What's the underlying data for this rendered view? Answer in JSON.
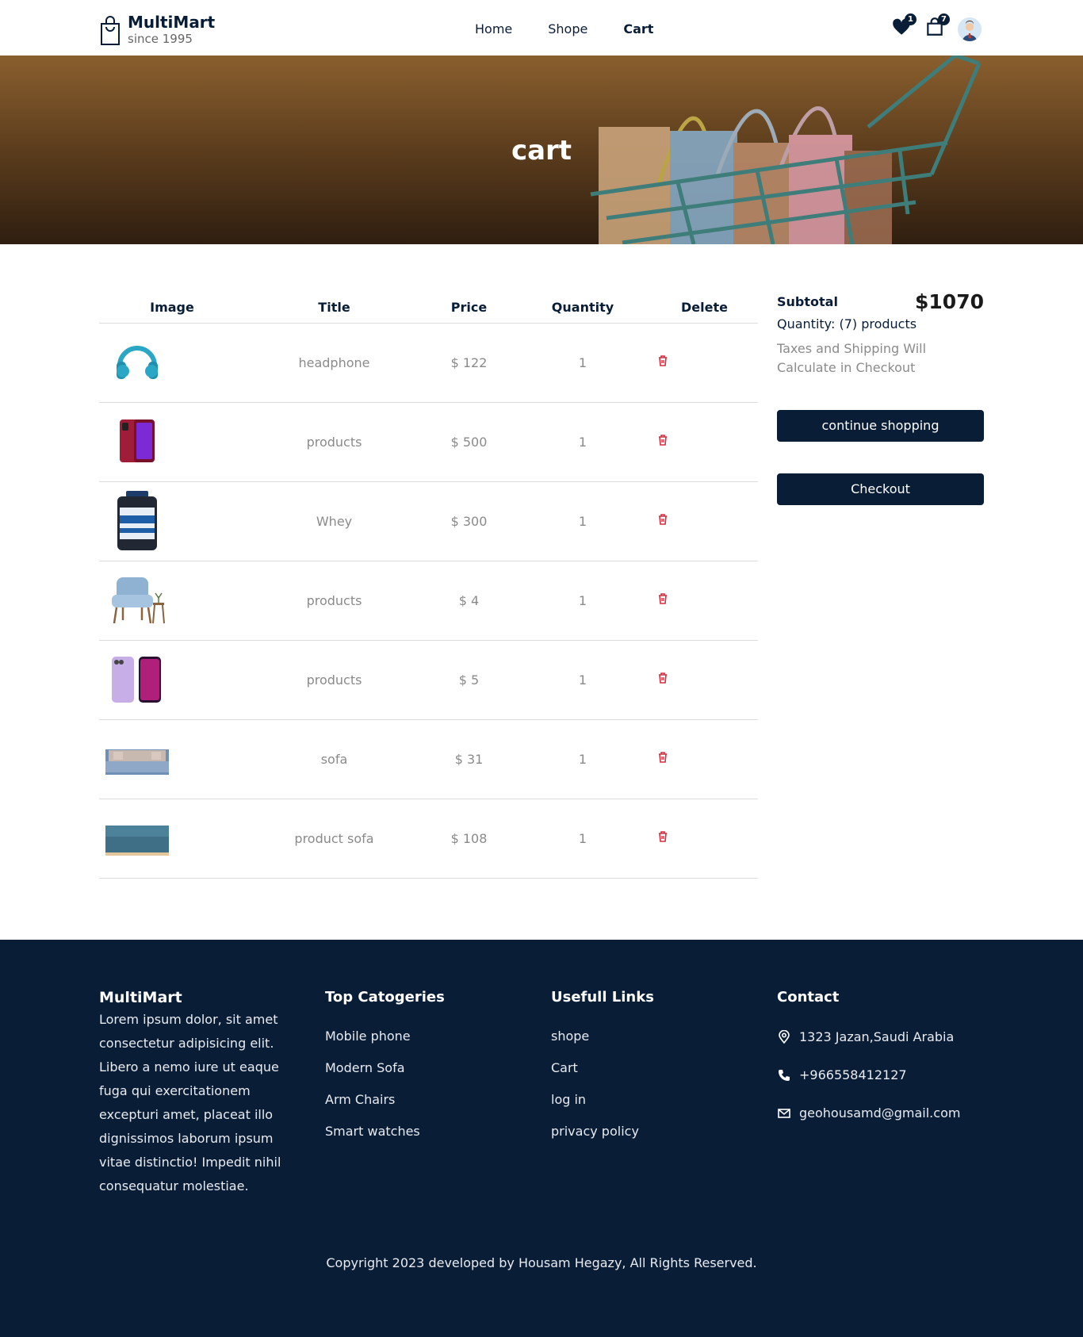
{
  "header": {
    "brand": "MultiMart",
    "tagline": "since 1995",
    "nav": [
      {
        "label": "Home",
        "active": false
      },
      {
        "label": "Shope",
        "active": false
      },
      {
        "label": "Cart",
        "active": true
      }
    ],
    "wishlist_count": "1",
    "cart_count": "7",
    "icons": [
      "shopping-bag-icon",
      "heart-icon",
      "cart-bag-icon",
      "user-avatar"
    ]
  },
  "hero": {
    "title": "cart"
  },
  "cart": {
    "columns": [
      "Image",
      "Title",
      "Price",
      "Quantity",
      "Delete"
    ],
    "rows": [
      {
        "image": "headphone-image",
        "title": "headphone",
        "price": "$ 122",
        "quantity": "1"
      },
      {
        "image": "red-phone-image",
        "title": "products",
        "price": "$ 500",
        "quantity": "1"
      },
      {
        "image": "whey-tub-image",
        "title": "Whey",
        "price": "$ 300",
        "quantity": "1"
      },
      {
        "image": "arm-chair-image",
        "title": "products",
        "price": "$ 4",
        "quantity": "1"
      },
      {
        "image": "purple-phone-image",
        "title": "products",
        "price": "$ 5",
        "quantity": "1"
      },
      {
        "image": "sofa-image",
        "title": "sofa",
        "price": "$ 31",
        "quantity": "1"
      },
      {
        "image": "teal-sofa-image",
        "title": "product sofa",
        "price": "$ 108",
        "quantity": "1"
      }
    ]
  },
  "summary": {
    "subtotal_label": "Subtotal",
    "subtotal_value": "$1070",
    "quantity_text": "Quantity: (7) products",
    "note": "Taxes and Shipping Will Calculate in Checkout",
    "continue_label": "continue shopping",
    "checkout_label": "Checkout"
  },
  "footer": {
    "brand": "MultiMart",
    "description": "Lorem ipsum dolor, sit amet consectetur adipisicing elit. Libero a nemo iure ut eaque fuga qui exercitationem excepturi amet, placeat illo dignissimos laborum ipsum vitae distinctio! Impedit nihil consequatur molestiae.",
    "categories_title": "Top Catogeries",
    "categories": [
      "Mobile phone",
      "Modern Sofa",
      "Arm Chairs",
      "Smart watches"
    ],
    "links_title": "Usefull Links",
    "links": [
      "shope",
      "Cart",
      "log in",
      "privacy policy"
    ],
    "contact_title": "Contact",
    "contact": {
      "address": "1323 Jazan,Saudi Arabia",
      "phone": "+966558412127",
      "email": "geohousamd@gmail.com"
    },
    "copyright": "Copyright 2023 developed by Housam Hegazy, All Rights Reserved."
  },
  "colors": {
    "primary": "#0a1d37",
    "delete": "#d32f3f",
    "muted": "#8a8a8a"
  }
}
